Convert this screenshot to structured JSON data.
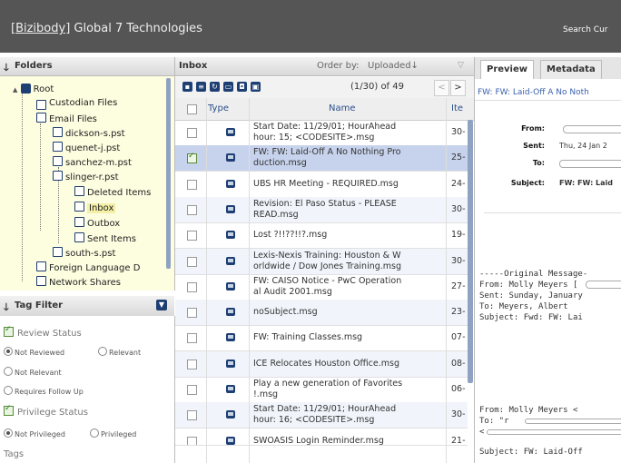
{
  "header": {
    "brand_link": "[Bizibody]",
    "brand_name": " Global 7 Technologies",
    "search_label": "Search Cur"
  },
  "folders": {
    "title": "Folders",
    "items": [
      {
        "label": "Root"
      },
      {
        "label": "Custodian Files"
      },
      {
        "label": "Email Files"
      },
      {
        "label": "dickson-s.pst"
      },
      {
        "label": "quenet-j.pst"
      },
      {
        "label": "sanchez-m.pst"
      },
      {
        "label": "slinger-r.pst"
      },
      {
        "label": "Deleted Items"
      },
      {
        "label": "Inbox"
      },
      {
        "label": "Outbox"
      },
      {
        "label": "Sent Items"
      },
      {
        "label": "south-s.pst"
      },
      {
        "label": "Foreign Language D"
      },
      {
        "label": "Network Shares"
      }
    ]
  },
  "tag_filter": {
    "title": "Tag Filter",
    "review_status": {
      "label": "Review Status",
      "checked": true
    },
    "review_options": [
      "Not Reviewed",
      "Relevant",
      "Not Relevant",
      "Requires Follow Up"
    ],
    "privilege_status": {
      "label": "Privilege Status",
      "checked": true
    },
    "privilege_options": [
      "Not Privileged",
      "Privileged"
    ],
    "tags_label": "Tags"
  },
  "inbox": {
    "title": "Inbox",
    "order_by_label": "Order by:",
    "order_by_value": "Uploaded↓",
    "pagination": "(1/30) of 49",
    "prev": "<",
    "next": ">",
    "columns": {
      "type": "Type",
      "name": "Name",
      "item": "Ite"
    },
    "rows": [
      {
        "line1": "Start Date: 11/29/01; HourAhead",
        "line2": "hour: 15; <CODESITE>.msg",
        "item": "30-"
      },
      {
        "line1": "FW: FW: Laid-Off A No Nothing Pro",
        "line2": "duction.msg",
        "item": "25-"
      },
      {
        "line1": "UBS HR Meeting - REQUIRED.msg",
        "line2": "",
        "item": "24-"
      },
      {
        "line1": "Revision: El Paso Status - PLEASE",
        "line2": "READ.msg",
        "item": "30-"
      },
      {
        "line1": "Lost ?!!??!!?.msg",
        "line2": "",
        "item": "19-"
      },
      {
        "line1": "Lexis-Nexis Training: Houston & W",
        "line2": "orldwide / Dow Jones Training.msg",
        "item": "30-"
      },
      {
        "line1": "FW: CAISO Notice - PwC Operation",
        "line2": "al Audit 2001.msg",
        "item": "27-"
      },
      {
        "line1": "noSubject.msg",
        "line2": "",
        "item": "23-"
      },
      {
        "line1": "FW: Training Classes.msg",
        "line2": "",
        "item": "07-"
      },
      {
        "line1": "ICE Relocates Houston Office.msg",
        "line2": "",
        "item": "08-"
      },
      {
        "line1": "Play a new generation of Favorites",
        "line2": "!.msg",
        "item": "06-"
      },
      {
        "line1": "Start Date: 11/29/01; HourAhead",
        "line2": "hour: 16; <CODESITE>.msg",
        "item": "30-"
      },
      {
        "line1": "SWOASIS Login Reminder.msg",
        "line2": "",
        "item": "21-"
      }
    ]
  },
  "preview": {
    "tabs": [
      "Preview",
      "Metadata"
    ],
    "subject_bar": "FW: FW: Laid-Off A No Noth",
    "from_label": "From:",
    "sent_label": "Sent:",
    "sent_value": "Thu, 24 Jan 2",
    "to_label": "To:",
    "subject_label": "Subject:",
    "subject_value": "FW: FW: Laid",
    "body": [
      "-----Original Message-",
      "From: Molly Meyers [",
      "Sent: Sunday, January",
      "To: Meyers, Albert",
      "Subject: Fwd: FW: Lai",
      "From: Molly Meyers <",
      "To: \"r",
      "<",
      "Subject: FW: Laid-Off"
    ]
  }
}
